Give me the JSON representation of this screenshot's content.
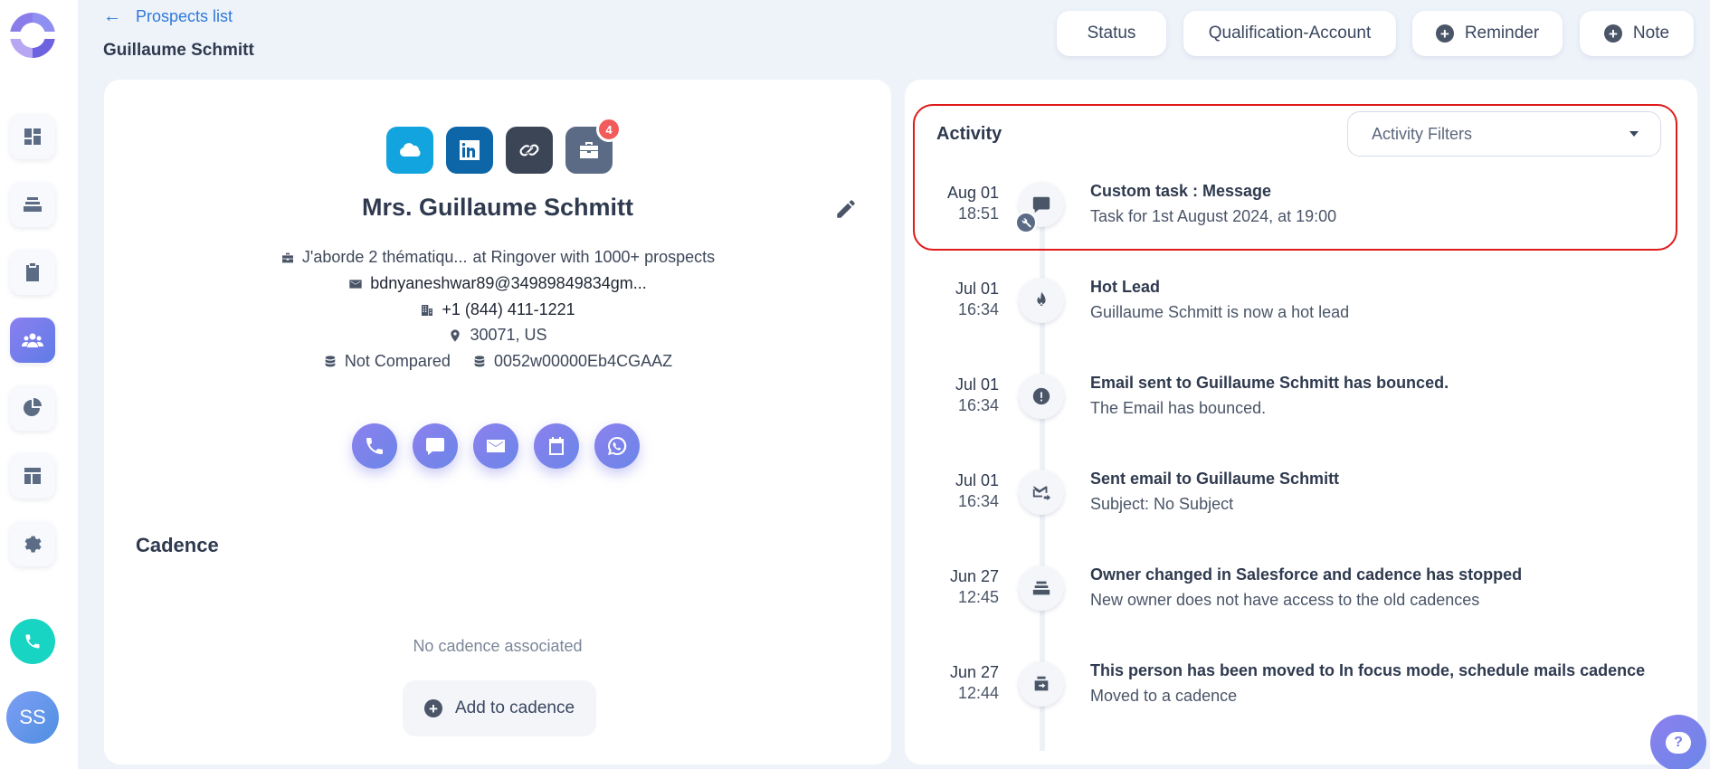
{
  "sidebar": {
    "items": [
      {
        "icon": "dashboard-icon"
      },
      {
        "icon": "stack-icon"
      },
      {
        "icon": "clipboard-icon"
      },
      {
        "icon": "people-icon",
        "active": true
      },
      {
        "icon": "pie-chart-icon"
      },
      {
        "icon": "layout-icon"
      },
      {
        "icon": "gear-icon"
      }
    ],
    "phone_icon": "phone-icon",
    "avatar_initials": "SS"
  },
  "header": {
    "back_label": "Prospects list",
    "back_arrow": "←",
    "title": "Guillaume Schmitt",
    "buttons": {
      "status": "Status",
      "qualification": "Qualification-Account",
      "reminder": "Reminder",
      "note": "Note"
    }
  },
  "prospect": {
    "badge_count": "4",
    "name": "Mrs. Guillaume Schmitt",
    "job": "J'aborde 2 thématiqu...",
    "company_at": "at Ringover with 1000+ prospects",
    "email": "bdnyaneshwar89@34989849834gm...",
    "phone": "+1 (844) 411-1221",
    "location": "30071, US",
    "compared": "Not Compared",
    "crm_id": "0052w00000Eb4CGAAZ"
  },
  "cadence": {
    "title": "Cadence",
    "empty_text": "No cadence associated",
    "add_label": "Add to cadence"
  },
  "activity": {
    "title": "Activity",
    "filter_label": "Activity Filters",
    "items": [
      {
        "date": "Aug 01",
        "time": "18:51",
        "icon": "chat-bubble-icon",
        "sub_icon": "wrench-icon",
        "title": "Custom task : Message",
        "desc": "Task for 1st August 2024, at 19:00"
      },
      {
        "date": "Jul 01",
        "time": "16:34",
        "icon": "flame-icon",
        "title": "Hot Lead",
        "desc": "Guillaume Schmitt is now a hot lead"
      },
      {
        "date": "Jul 01",
        "time": "16:34",
        "icon": "alert-icon",
        "title": "Email sent to Guillaume Schmitt has bounced.",
        "desc": "The Email has bounced."
      },
      {
        "date": "Jul 01",
        "time": "16:34",
        "icon": "mail-sent-icon",
        "title": "Sent email to Guillaume Schmitt",
        "desc": "Subject: No Subject"
      },
      {
        "date": "Jun 27",
        "time": "12:45",
        "icon": "stack-icon",
        "title": "Owner changed in Salesforce and cadence has stopped",
        "desc": "New owner does not have access to the old cadences"
      },
      {
        "date": "Jun 27",
        "time": "12:44",
        "icon": "move-icon",
        "title": "This person has been moved to In focus mode, schedule mails cadence",
        "desc": "Moved to a cadence"
      }
    ]
  },
  "help": {
    "label": "?"
  },
  "colors": {
    "accent": "#2f78d9",
    "highlight": "#e01a1a",
    "badge": "#f25b5b"
  }
}
